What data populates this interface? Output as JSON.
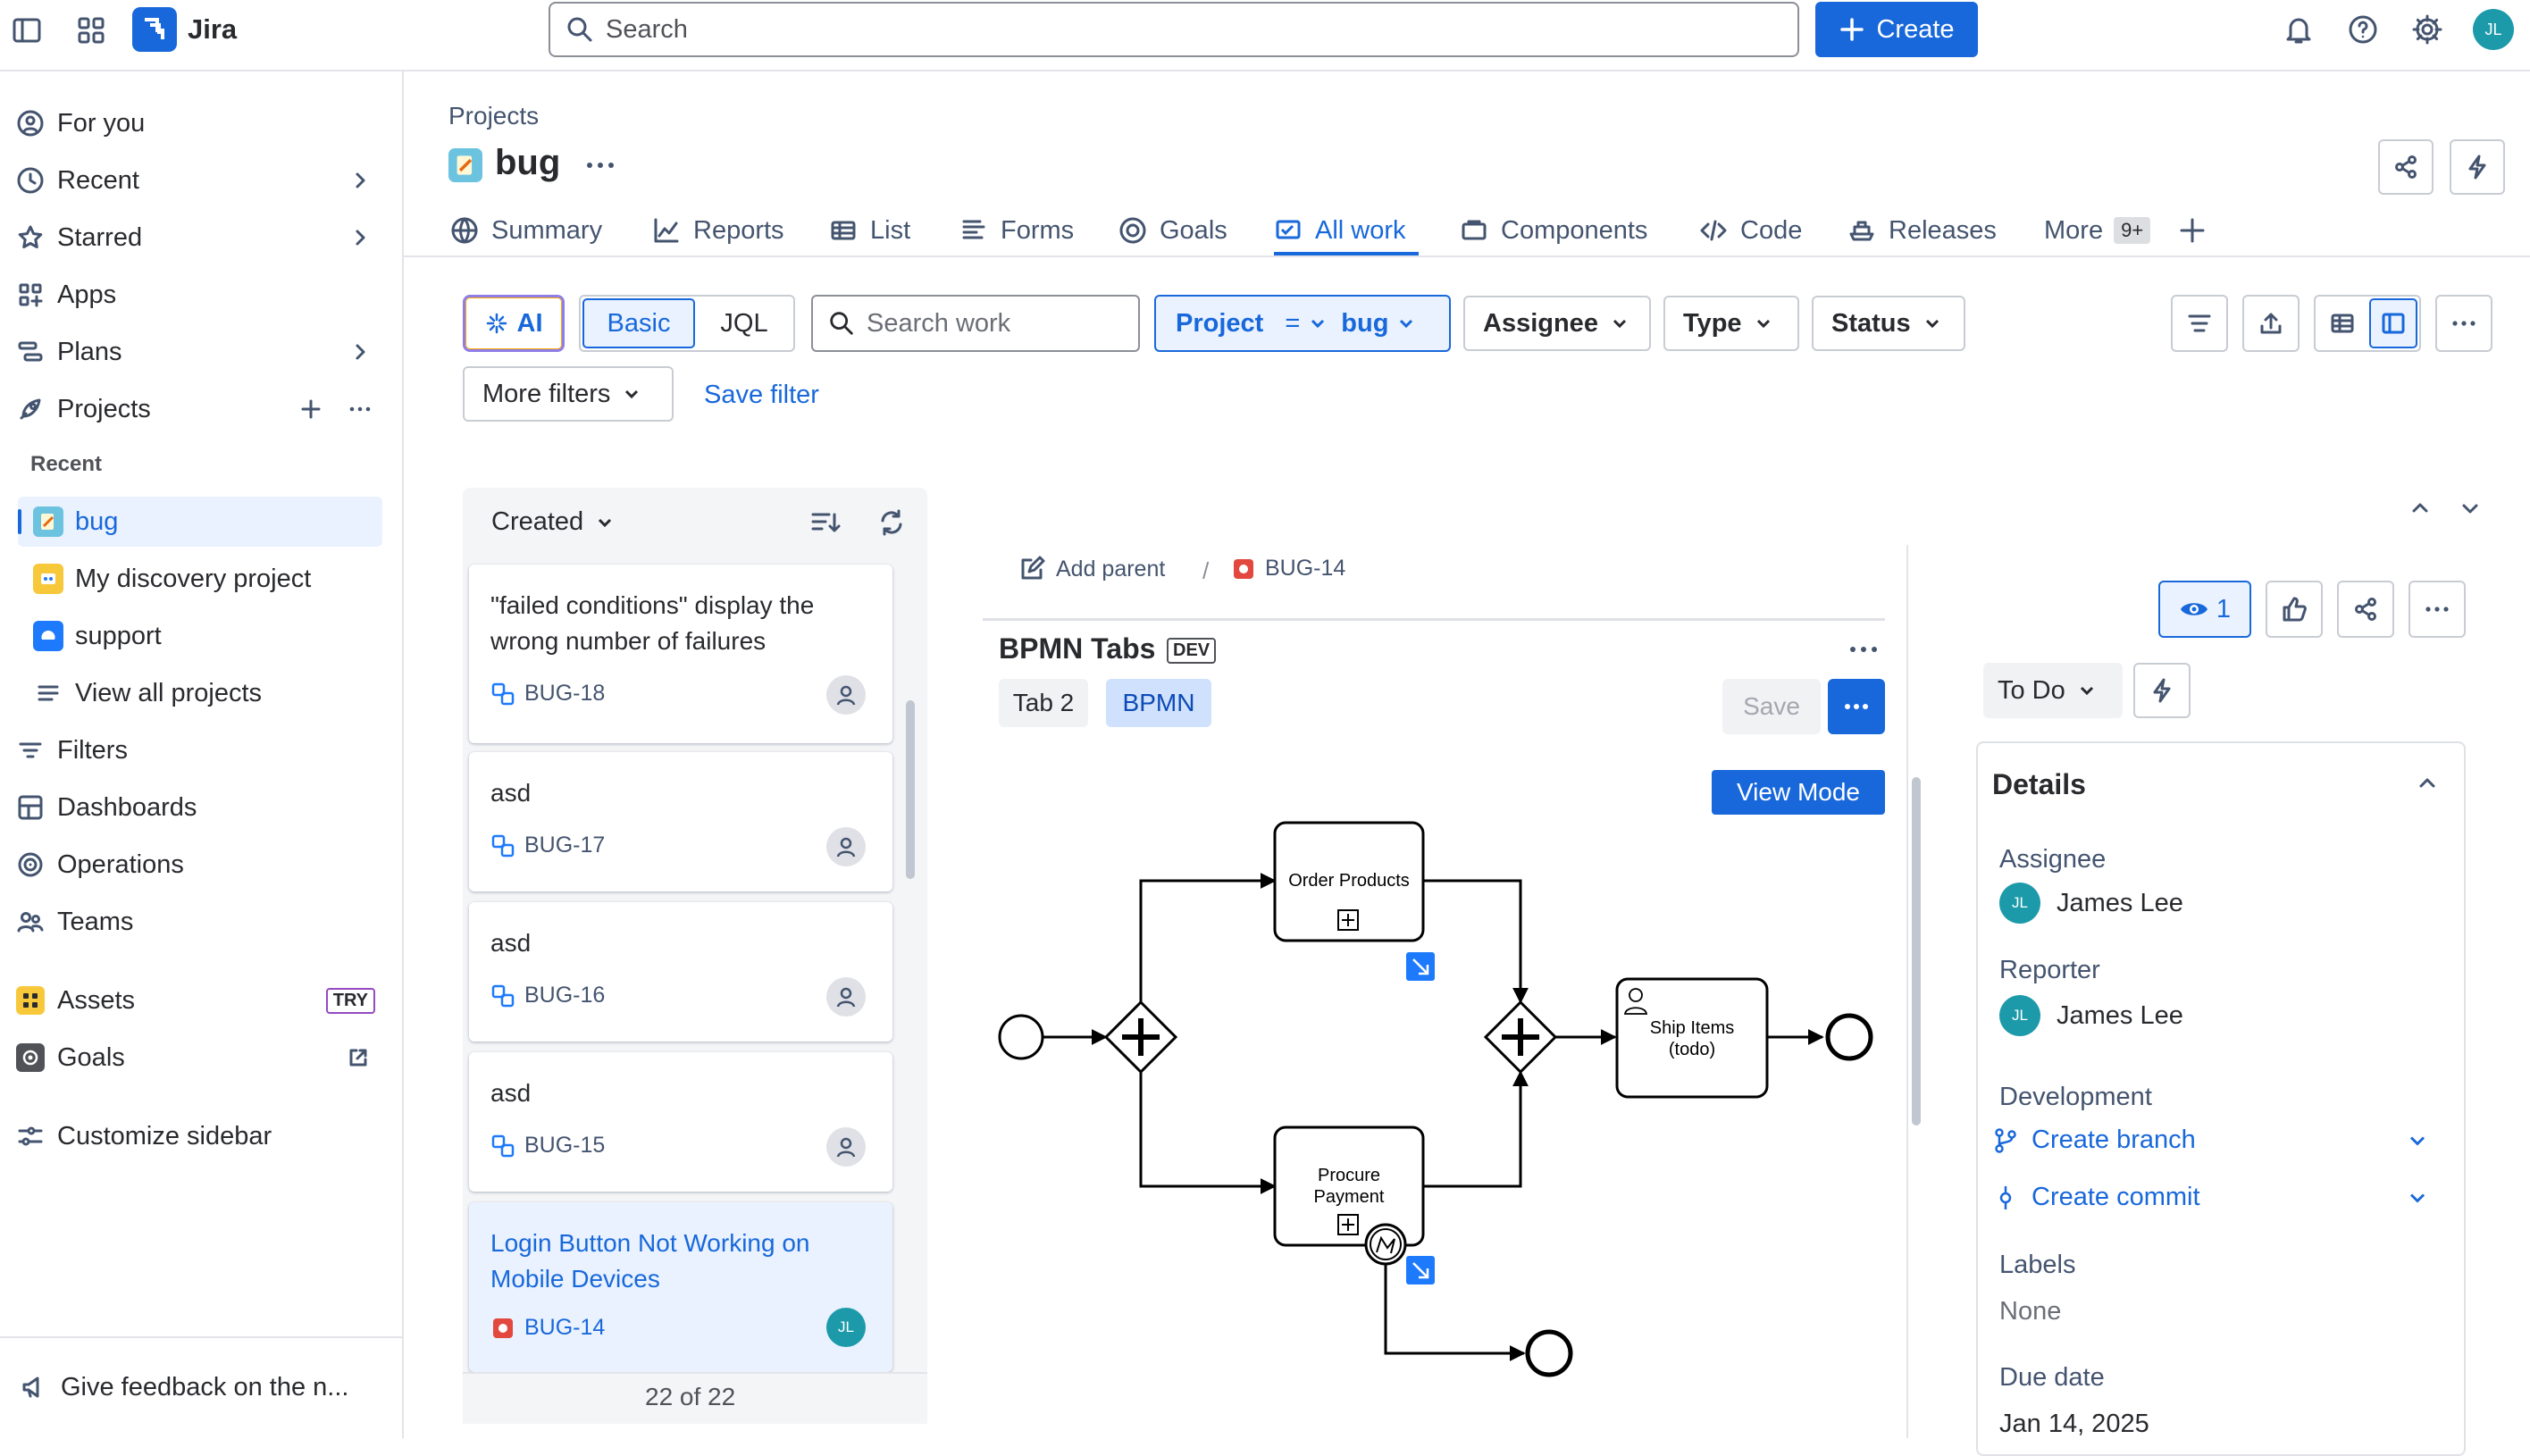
{
  "topbar": {
    "app_name": "Jira",
    "search_placeholder": "Search",
    "create_label": "Create",
    "avatar_initials": "JL"
  },
  "sidebar": {
    "items": [
      {
        "label": "For you"
      },
      {
        "label": "Recent"
      },
      {
        "label": "Starred"
      },
      {
        "label": "Apps"
      },
      {
        "label": "Plans"
      },
      {
        "label": "Projects"
      }
    ],
    "recent_heading": "Recent",
    "recent_projects": [
      {
        "label": "bug"
      },
      {
        "label": "My discovery project"
      },
      {
        "label": "support"
      },
      {
        "label": "View all projects"
      }
    ],
    "items2": [
      {
        "label": "Filters"
      },
      {
        "label": "Dashboards"
      },
      {
        "label": "Operations"
      },
      {
        "label": "Teams"
      }
    ],
    "assets": {
      "label": "Assets",
      "badge": "TRY"
    },
    "goals": {
      "label": "Goals"
    },
    "customize": "Customize sidebar",
    "feedback": "Give feedback on the n..."
  },
  "project": {
    "breadcrumb": "Projects",
    "name": "bug",
    "tabs": [
      {
        "label": "Summary"
      },
      {
        "label": "Reports"
      },
      {
        "label": "List"
      },
      {
        "label": "Forms"
      },
      {
        "label": "Goals"
      },
      {
        "label": "All work"
      },
      {
        "label": "Components"
      },
      {
        "label": "Code"
      },
      {
        "label": "Releases"
      },
      {
        "label": "More"
      }
    ],
    "more_badge": "9+"
  },
  "filters": {
    "ai_label": "AI",
    "basic_label": "Basic",
    "jql_label": "JQL",
    "search_placeholder": "Search work",
    "project_label": "Project",
    "project_op": "=",
    "project_value": "bug",
    "assignee_label": "Assignee",
    "type_label": "Type",
    "status_label": "Status",
    "more_filters_label": "More filters",
    "save_filter_label": "Save filter"
  },
  "list": {
    "sort_label": "Created",
    "cards": [
      {
        "title": "\"failed conditions\" display the wrong number of failures",
        "key": "BUG-18"
      },
      {
        "title": "asd",
        "key": "BUG-17"
      },
      {
        "title": "asd",
        "key": "BUG-16"
      },
      {
        "title": "asd",
        "key": "BUG-15"
      },
      {
        "title": "Login Button Not Working on Mobile Devices",
        "key": "BUG-14",
        "avatar": "JL"
      }
    ],
    "count": "22 of 22"
  },
  "issue": {
    "add_parent": "Add parent",
    "separator": "/",
    "key": "BUG-14",
    "panel_title": "BPMN Tabs",
    "panel_badge": "DEV",
    "tabs": [
      {
        "label": "Tab 2"
      },
      {
        "label": "BPMN"
      }
    ],
    "save_label": "Save",
    "view_mode_label": "View Mode",
    "bpmn": {
      "task1": "Order Products",
      "task2_line1": "Procure",
      "task2_line2": "Payment",
      "task3_line1": "Ship Items",
      "task3_line2": "(todo)"
    }
  },
  "details": {
    "watch_count": "1",
    "status_label": "To Do",
    "heading": "Details",
    "assignee_label": "Assignee",
    "assignee_name": "James Lee",
    "assignee_initials": "JL",
    "reporter_label": "Reporter",
    "reporter_name": "James Lee",
    "reporter_initials": "JL",
    "development_label": "Development",
    "create_branch": "Create branch",
    "create_commit": "Create commit",
    "labels_label": "Labels",
    "labels_value": "None",
    "due_date_label": "Due date",
    "due_date_value": "Jan 14, 2025"
  },
  "colors": {
    "accent": "#1868db",
    "selected_bg": "#e9f2fe",
    "text": "#292a2e",
    "subtle": "#44546f",
    "avatar": "#1d9aaa",
    "bug_red": "#e2483d"
  }
}
